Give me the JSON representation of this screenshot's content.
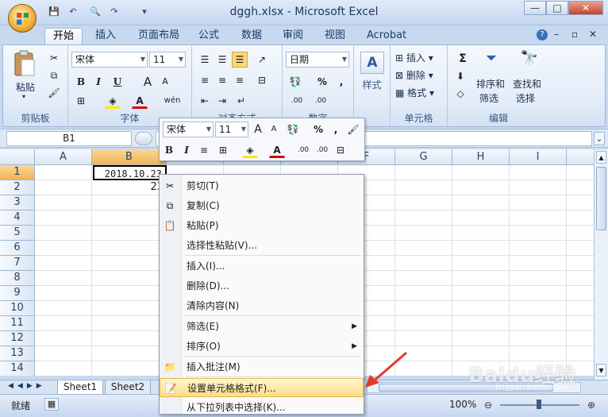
{
  "window": {
    "title": "dggh.xlsx - Microsoft Excel",
    "minimize": "—",
    "maximize": "□",
    "close": "✕"
  },
  "tabs": [
    "开始",
    "插入",
    "页面布局",
    "公式",
    "数据",
    "审阅",
    "视图",
    "Acrobat"
  ],
  "ribbon": {
    "clipboard": {
      "paste": "粘贴",
      "label": "剪贴板"
    },
    "font": {
      "name": "宋体",
      "size": "11",
      "label": "字体",
      "bold": "B",
      "italic": "I",
      "underline": "U",
      "grow": "A",
      "shrink": "A"
    },
    "alignment": {
      "label": "对齐方式"
    },
    "number": {
      "format": "日期",
      "label": "数字",
      "percent": "%",
      "comma": ",",
      "inc": ".00",
      "dec": ".00"
    },
    "styles": {
      "label": "样式"
    },
    "cells": {
      "insert": "插入",
      "delete": "删除",
      "format": "格式",
      "label": "单元格"
    },
    "editing": {
      "sum": "Σ",
      "sort1": "排序和",
      "sort2": "筛选",
      "find1": "查找和",
      "find2": "选择",
      "label": "编辑"
    }
  },
  "formula_bar": {
    "name_box": "B1",
    "fx": "fx"
  },
  "columns": [
    "A",
    "B",
    "C",
    "D",
    "E",
    "F",
    "G",
    "H",
    "I"
  ],
  "rows": [
    "1",
    "2",
    "3",
    "4",
    "5",
    "6",
    "7",
    "8",
    "9",
    "10",
    "11",
    "12",
    "13",
    "14"
  ],
  "cells": {
    "B1": "2018.10.23",
    "B2": "23"
  },
  "sheet_tabs": [
    "Sheet1",
    "Sheet2"
  ],
  "status": {
    "ready": "就绪",
    "zoom": "100%"
  },
  "minibar": {
    "font": "宋体",
    "size": "11",
    "percent": "%",
    "comma": ","
  },
  "context_menu": [
    {
      "label": "剪切(T)",
      "icon": "scissors-icon"
    },
    {
      "label": "复制(C)",
      "icon": "copy-icon"
    },
    {
      "label": "粘贴(P)",
      "icon": "paste-icon"
    },
    {
      "label": "选择性粘贴(V)...",
      "icon": ""
    },
    {
      "label": "插入(I)...",
      "icon": ""
    },
    {
      "label": "删除(D)...",
      "icon": ""
    },
    {
      "label": "清除内容(N)",
      "icon": ""
    },
    {
      "label": "筛选(E)",
      "icon": "",
      "submenu": true
    },
    {
      "label": "排序(O)",
      "icon": "",
      "submenu": true
    },
    {
      "label": "插入批注(M)",
      "icon": "comment-icon"
    },
    {
      "label": "设置单元格格式(F)...",
      "icon": "format-cells-icon",
      "highlighted": true
    },
    {
      "label": "从下拉列表中选择(K)...",
      "icon": ""
    }
  ],
  "watermark": {
    "text": "Baidu经验",
    "url": "jingyan.baidu.com"
  },
  "colors": {
    "accent": "#c7d9ef",
    "highlight": "#fcdc86",
    "arrow": "#e23a2a"
  }
}
